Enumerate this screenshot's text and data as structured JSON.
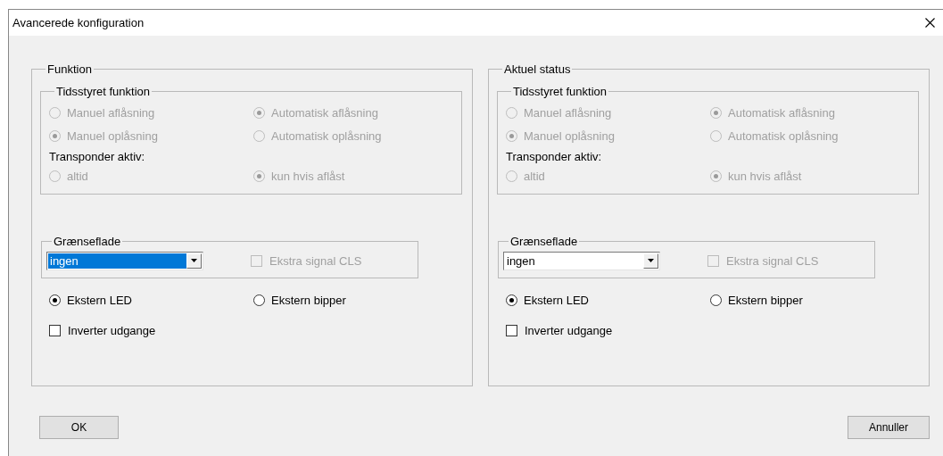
{
  "window": {
    "title": "Avancerede konfiguration"
  },
  "panels": [
    {
      "title": "Funktion",
      "timed": {
        "title": "Tidsstyret funktion",
        "options": [
          {
            "label": "Manuel aflåsning",
            "selected": false,
            "disabled": true
          },
          {
            "label": "Automatisk aflåsning",
            "selected": true,
            "disabled": true
          },
          {
            "label": "Manuel oplåsning",
            "selected": true,
            "disabled": true
          },
          {
            "label": "Automatisk oplåsning",
            "selected": false,
            "disabled": true
          }
        ],
        "transponder_label": "Transponder aktiv:",
        "transponder_options": [
          {
            "label": "altid",
            "selected": false,
            "disabled": true
          },
          {
            "label": "kun hvis aflåst",
            "selected": true,
            "disabled": true
          }
        ]
      },
      "interface": {
        "title": "Grænseflade",
        "value": "ingen",
        "highlighted": true,
        "extra_signal": {
          "label": "Ekstra signal CLS",
          "checked": false,
          "disabled": true
        }
      },
      "outputs": [
        {
          "label": "Ekstern LED",
          "selected": true
        },
        {
          "label": "Ekstern bipper",
          "selected": false
        }
      ],
      "invert": {
        "label": "Inverter udgange",
        "checked": false
      }
    },
    {
      "title": "Aktuel status",
      "timed": {
        "title": "Tidsstyret funktion",
        "options": [
          {
            "label": "Manuel aflåsning",
            "selected": false,
            "disabled": true
          },
          {
            "label": "Automatisk aflåsning",
            "selected": true,
            "disabled": true
          },
          {
            "label": "Manuel oplåsning",
            "selected": true,
            "disabled": true
          },
          {
            "label": "Automatisk oplåsning",
            "selected": false,
            "disabled": true
          }
        ],
        "transponder_label": "Transponder aktiv:",
        "transponder_options": [
          {
            "label": "altid",
            "selected": false,
            "disabled": true
          },
          {
            "label": "kun hvis aflåst",
            "selected": true,
            "disabled": true
          }
        ]
      },
      "interface": {
        "title": "Grænseflade",
        "value": "ingen",
        "highlighted": false,
        "extra_signal": {
          "label": "Ekstra signal CLS",
          "checked": false,
          "disabled": true
        }
      },
      "outputs": [
        {
          "label": "Ekstern LED",
          "selected": true
        },
        {
          "label": "Ekstern bipper",
          "selected": false
        }
      ],
      "invert": {
        "label": "Inverter udgange",
        "checked": false
      }
    }
  ],
  "buttons": [
    {
      "label": "OK"
    },
    {
      "label": "Annuller"
    }
  ]
}
